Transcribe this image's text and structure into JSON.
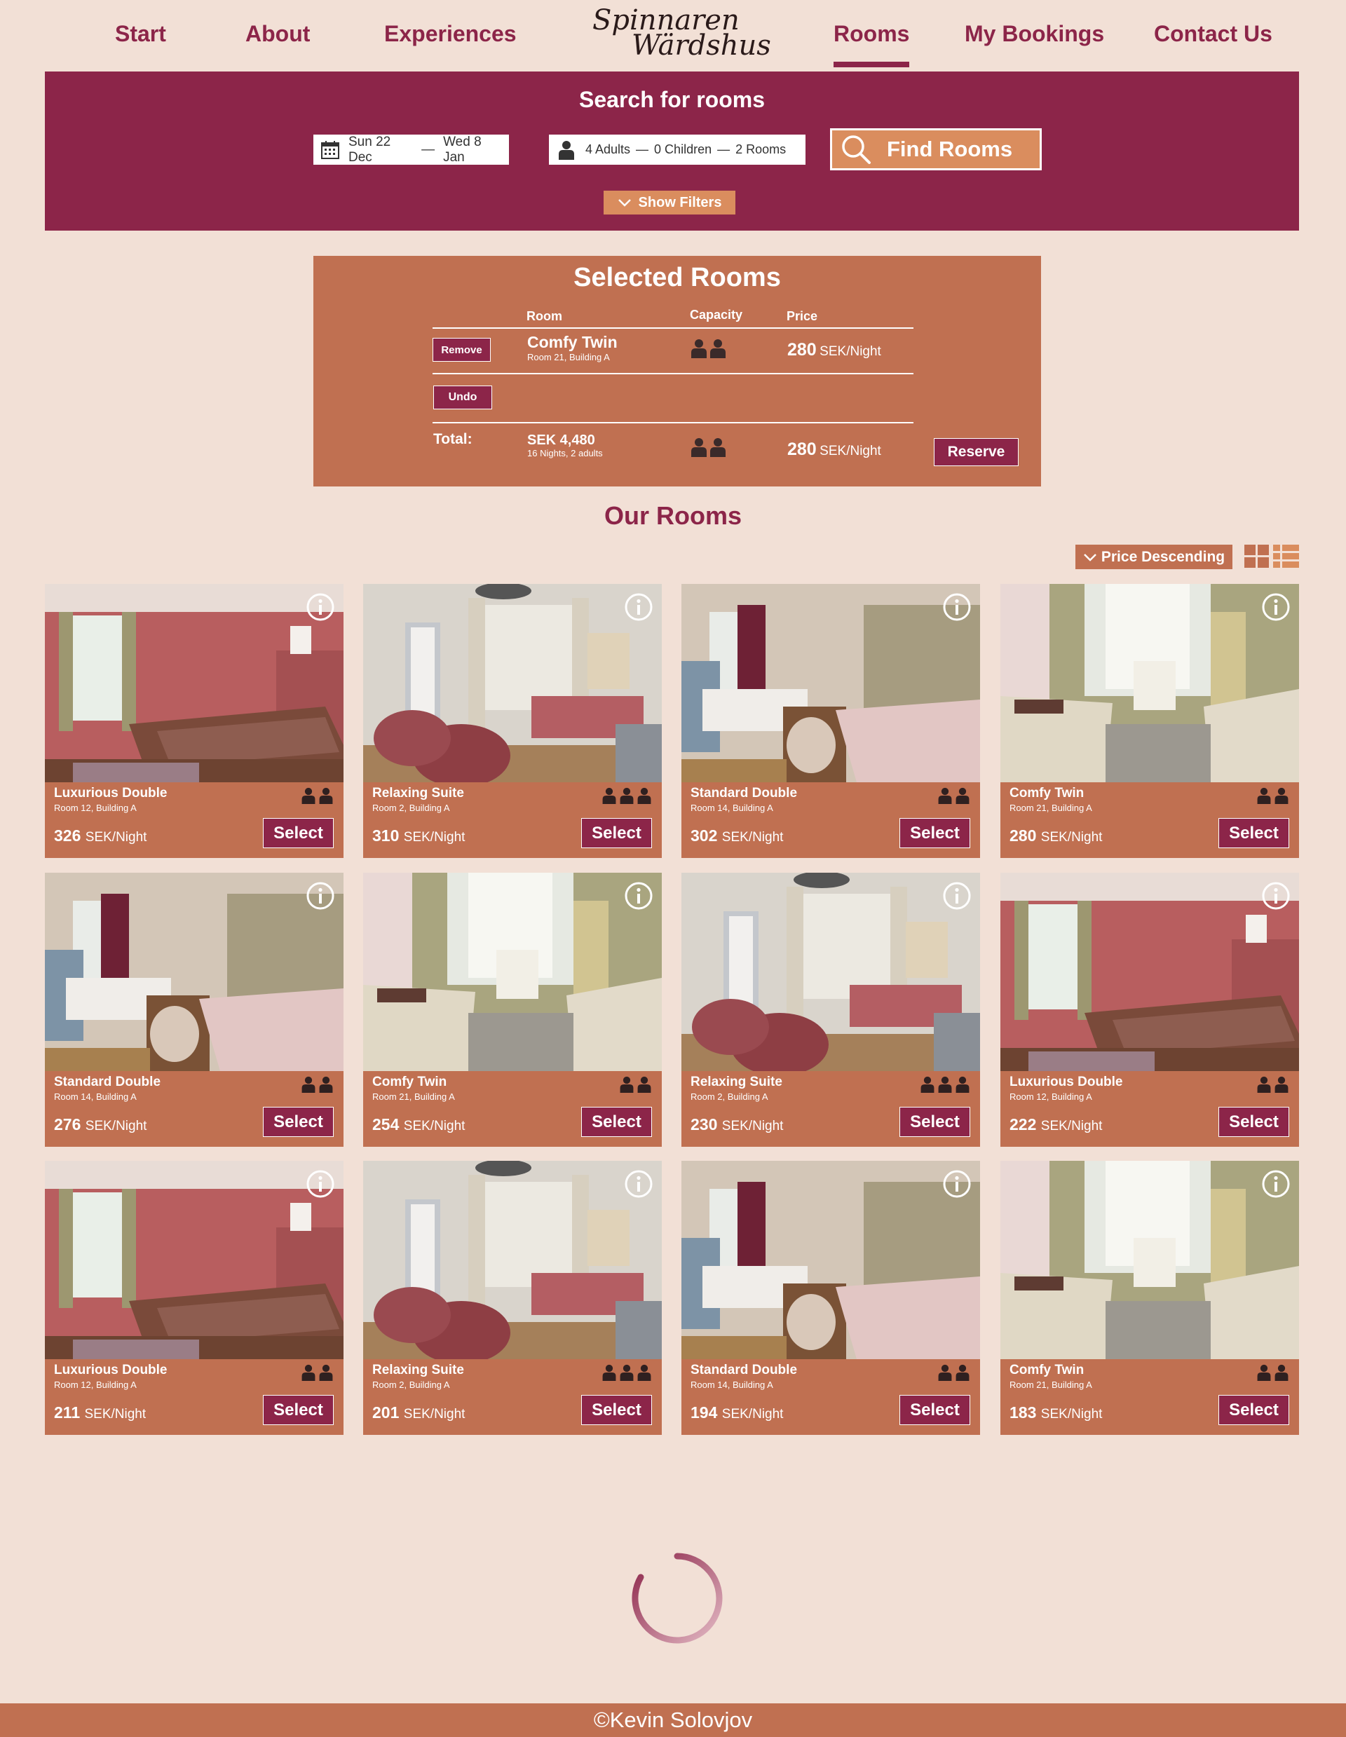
{
  "nav": {
    "start": "Start",
    "about": "About",
    "experiences": "Experiences",
    "logo_line1": "Spinnaren",
    "logo_line2": "Wärdshus",
    "rooms": "Rooms",
    "my_bookings": "My Bookings",
    "contact": "Contact Us",
    "active": "Rooms"
  },
  "search": {
    "title": "Search for rooms",
    "date_from": "Sun 22 Dec",
    "date_to": "Wed 8 Jan",
    "adults": "4 Adults",
    "children": "0 Children",
    "rooms": "2 Rooms",
    "sep": "—",
    "find_label": "Find Rooms",
    "filters_label": "Show Filters"
  },
  "selected": {
    "title": "Selected Rooms",
    "col_room": "Room",
    "col_capacity": "Capacity",
    "col_price": "Price",
    "row": {
      "remove_label": "Remove",
      "room_name": "Comfy Twin",
      "room_location": "Room 21, Building A",
      "capacity": 2,
      "price": "280",
      "unit": "SEK/Night"
    },
    "undo_label": "Undo",
    "total_label": "Total:",
    "total_amount": "SEK 4,480",
    "total_detail": "16 Nights, 2 adults",
    "total_capacity": 2,
    "total_price": "280",
    "total_unit": "SEK/Night",
    "reserve_label": "Reserve"
  },
  "rooms_heading": "Our Rooms",
  "sort_label": "Price Descending",
  "select_label": "Select",
  "unit_label": "SEK/Night",
  "rooms": [
    {
      "name": "Luxurious Double",
      "location": "Room 12, Building A",
      "price": "326",
      "capacity": 2,
      "photo": "red-bedroom"
    },
    {
      "name": "Relaxing Suite",
      "location": "Room 2, Building A",
      "price": "310",
      "capacity": 3,
      "photo": "lounge"
    },
    {
      "name": "Standard Double",
      "location": "Room 14, Building A",
      "price": "302",
      "capacity": 2,
      "photo": "floral-bedroom"
    },
    {
      "name": "Comfy Twin",
      "location": "Room 21, Building A",
      "price": "280",
      "capacity": 2,
      "photo": "twin-bedroom"
    },
    {
      "name": "Standard Double",
      "location": "Room 14, Building A",
      "price": "276",
      "capacity": 2,
      "photo": "floral-bedroom"
    },
    {
      "name": "Comfy Twin",
      "location": "Room 21, Building A",
      "price": "254",
      "capacity": 2,
      "photo": "twin-bedroom"
    },
    {
      "name": "Relaxing Suite",
      "location": "Room 2, Building A",
      "price": "230",
      "capacity": 3,
      "photo": "lounge"
    },
    {
      "name": "Luxurious Double",
      "location": "Room 12, Building A",
      "price": "222",
      "capacity": 2,
      "photo": "red-bedroom"
    },
    {
      "name": "Luxurious Double",
      "location": "Room 12, Building A",
      "price": "211",
      "capacity": 2,
      "photo": "red-bedroom"
    },
    {
      "name": "Relaxing Suite",
      "location": "Room 2, Building A",
      "price": "201",
      "capacity": 3,
      "photo": "lounge"
    },
    {
      "name": "Standard Double",
      "location": "Room 14, Building A",
      "price": "194",
      "capacity": 2,
      "photo": "floral-bedroom"
    },
    {
      "name": "Comfy Twin",
      "location": "Room 21, Building A",
      "price": "183",
      "capacity": 2,
      "photo": "twin-bedroom"
    }
  ],
  "footer": "©Kevin Solovjov",
  "colors": {
    "brand": "#8c2549",
    "accent": "#c07051",
    "accent_light": "#da8d5e",
    "background": "#f2e0d6"
  }
}
